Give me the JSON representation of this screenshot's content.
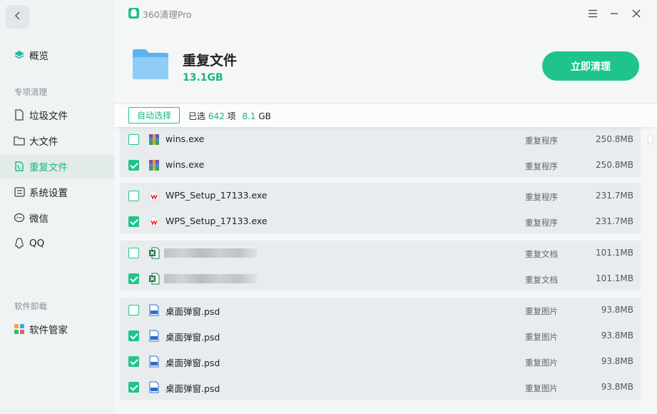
{
  "sidebar": {
    "back_icon": "chevron-left-icon",
    "overview": "概览",
    "section_special": "专项清理",
    "items": [
      {
        "label": "垃圾文件",
        "icon": "trash-file-icon"
      },
      {
        "label": "大文件",
        "icon": "folder-icon"
      },
      {
        "label": "重复文件",
        "icon": "duplicate-file-icon"
      },
      {
        "label": "系统设置",
        "icon": "settings-panel-icon"
      },
      {
        "label": "微信",
        "icon": "wechat-icon"
      },
      {
        "label": "QQ",
        "icon": "qq-icon"
      }
    ],
    "section_software": "软件卸载",
    "software_manager": "软件管家"
  },
  "titlebar": {
    "app_name": "360清理Pro",
    "menu_icon": "☰",
    "minimize_icon": "—",
    "close_icon": "✕"
  },
  "header": {
    "title": "重复文件",
    "size": "13.1GB",
    "clean_button": "立即清理"
  },
  "toolbar": {
    "auto_select": "自动选择",
    "selected_prefix": "已选",
    "selected_count": "642",
    "count_unit": "项",
    "selected_size": "8.1",
    "size_unit": "GB"
  },
  "groups": [
    {
      "rows": [
        {
          "name": "wins.exe",
          "type": "重复程序",
          "size": "250.8MB",
          "checked": false,
          "icon": "winrar-icon"
        },
        {
          "name": "wins.exe",
          "type": "重复程序",
          "size": "250.8MB",
          "checked": true,
          "icon": "winrar-icon"
        }
      ]
    },
    {
      "rows": [
        {
          "name": "WPS_Setup_17133.exe",
          "type": "重复程序",
          "size": "231.7MB",
          "checked": false,
          "icon": "wps-icon"
        },
        {
          "name": "WPS_Setup_17133.exe",
          "type": "重复程序",
          "size": "231.7MB",
          "checked": true,
          "icon": "wps-icon"
        }
      ]
    },
    {
      "rows": [
        {
          "name": "",
          "type": "重复文档",
          "size": "101.1MB",
          "checked": false,
          "icon": "excel-icon",
          "blurred": true
        },
        {
          "name": "",
          "type": "重复文档",
          "size": "101.1MB",
          "checked": true,
          "icon": "excel-icon",
          "blurred": true
        }
      ]
    },
    {
      "rows": [
        {
          "name": "桌面弹窗.psd",
          "type": "重复图片",
          "size": "93.8MB",
          "checked": false,
          "icon": "psd-icon"
        },
        {
          "name": "桌面弹窗.psd",
          "type": "重复图片",
          "size": "93.8MB",
          "checked": true,
          "icon": "psd-icon"
        },
        {
          "name": "桌面弹窗.psd",
          "type": "重复图片",
          "size": "93.8MB",
          "checked": true,
          "icon": "psd-icon"
        },
        {
          "name": "桌面弹窗.psd",
          "type": "重复图片",
          "size": "93.8MB",
          "checked": true,
          "icon": "psd-icon"
        }
      ]
    }
  ],
  "colors": {
    "accent": "#1fc48a",
    "accent_text": "#1ab57d",
    "sidebar_bg": "#f0f3f4",
    "group_bg": "#e8ecef"
  }
}
